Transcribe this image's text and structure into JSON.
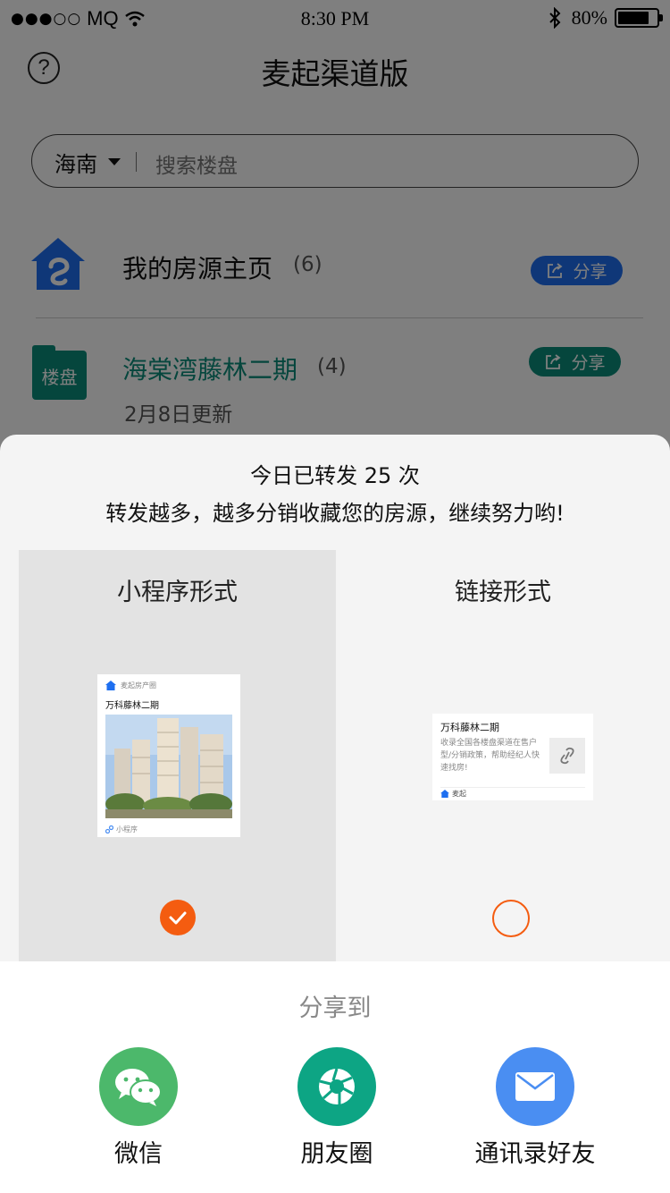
{
  "status_bar": {
    "signal": "●●●○○",
    "carrier": "MQ",
    "time": "8:30 PM",
    "battery": "80%"
  },
  "nav": {
    "title": "麦起渠道版",
    "help_icon": "?"
  },
  "search": {
    "city": "海南",
    "placeholder": "搜索楼盘"
  },
  "list": [
    {
      "title": "我的房源主页",
      "count": "(6)",
      "share_label": "分享",
      "icon": "home-icon"
    },
    {
      "title": "海棠湾藤林二期",
      "count": "(4)",
      "share_label": "分享",
      "date": "2月8日更新",
      "icon": "folder-icon",
      "folder_label": "楼盘"
    }
  ],
  "sheet": {
    "line1": "今日已转发 25 次",
    "line2": "转发越多，越多分销收藏您的房源，继续努力哟!",
    "options": [
      {
        "label": "小程序形式",
        "selected": true,
        "preview": {
          "brand": "麦起房产圈",
          "title": "万科藤林二期",
          "footer": "小程序"
        }
      },
      {
        "label": "链接形式",
        "selected": false,
        "preview": {
          "title": "万科藤林二期",
          "desc": "收录全国各楼盘渠道在售户型/分销政策，帮助经纪人快速找房!",
          "footer": "麦起"
        }
      }
    ],
    "share_to": "分享到",
    "targets": [
      {
        "label": "微信",
        "icon": "wechat-icon",
        "color": "#4cb86b"
      },
      {
        "label": "朋友圈",
        "icon": "moments-icon",
        "color": "#0da584"
      },
      {
        "label": "通讯录好友",
        "icon": "mail-icon",
        "color": "#4a8ef2"
      }
    ]
  },
  "colors": {
    "accent_orange": "#f45c10",
    "brand_blue": "#1e6ff0",
    "teal": "#0b8d7a",
    "overlay": "rgba(0,0,0,0.5)"
  }
}
